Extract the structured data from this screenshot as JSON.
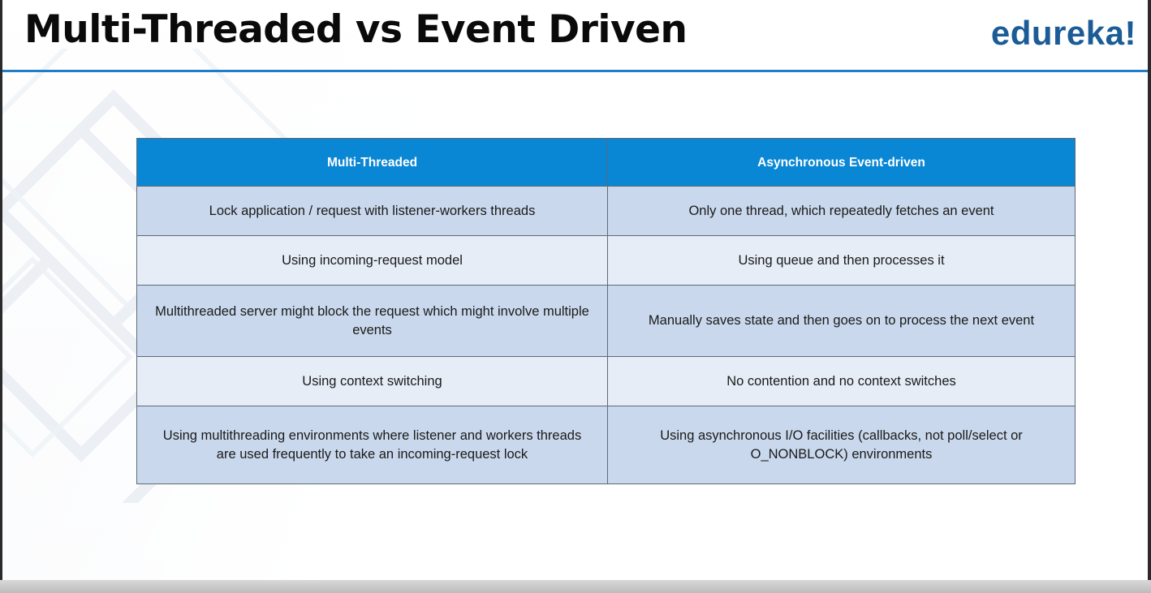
{
  "header": {
    "title": "Multi-Threaded vs Event Driven",
    "logo": "edureka!"
  },
  "colors": {
    "accent": "#1f7ec7",
    "header_cell": "#0a87d4",
    "row_dark": "#c9d8ec",
    "row_light": "#e6edf7",
    "logo": "#1b5c97"
  },
  "table": {
    "headers": [
      "Multi-Threaded",
      "Asynchronous Event-driven"
    ],
    "rows": [
      [
        "Lock application / request with listener-workers threads",
        "Only one thread, which repeatedly fetches an event"
      ],
      [
        "Using incoming-request model",
        "Using queue and then processes it"
      ],
      [
        "Multithreaded server might block the request which might involve multiple events",
        "Manually saves state and then goes on to process the next event"
      ],
      [
        "Using context switching",
        "No contention and no context switches"
      ],
      [
        "Using multithreading environments where listener and workers threads are used frequently to take an incoming-request lock",
        "Using asynchronous I/O facilities (callbacks, not poll/select or O_NONBLOCK) environments"
      ]
    ]
  }
}
